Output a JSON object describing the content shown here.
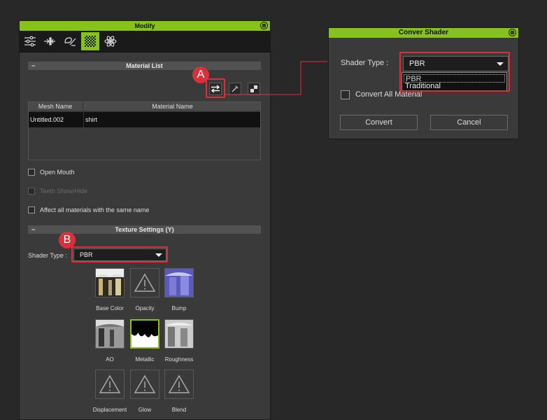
{
  "modify_panel": {
    "title": "Modify",
    "close_glyph": "⊗",
    "tabs": [
      {
        "name": "sliders-icon"
      },
      {
        "name": "motion-icon"
      },
      {
        "name": "attribute-icon"
      },
      {
        "name": "material-icon",
        "active": true
      },
      {
        "name": "physics-icon"
      }
    ],
    "material_list": {
      "collapse_glyph": "−",
      "header": "Material List",
      "columns": [
        "Mesh Name",
        "Material Name"
      ],
      "rows": [
        {
          "mesh": "Untitled.002",
          "material": "shirt"
        }
      ]
    },
    "options": {
      "open_mouth": "Open Mouth",
      "teeth": "Teeth Show/Hide",
      "affect_all": "Affect all materials with the same name"
    },
    "texture_settings": {
      "collapse_glyph": "−",
      "header": "Texture Settings  (Y)",
      "shader_type_label": "Shader Type :",
      "shader_type_value": "PBR",
      "channels": [
        {
          "label": "Base Color"
        },
        {
          "label": "Opacity"
        },
        {
          "label": "Bump"
        },
        {
          "label": "AO"
        },
        {
          "label": "Metallic"
        },
        {
          "label": "Roughness"
        },
        {
          "label": "Displacement"
        },
        {
          "label": "Glow"
        },
        {
          "label": "Blend"
        }
      ]
    }
  },
  "markers": {
    "a": "A",
    "b": "B"
  },
  "dialog": {
    "title": "Conver Shader",
    "close_glyph": "⊗",
    "shader_type_label": "Shader Type :",
    "shader_type_value": "PBR",
    "options": [
      "PBR",
      "Traditional"
    ],
    "convert_all_label": "Convert All Material",
    "convert_button": "Convert",
    "cancel_button": "Cancel"
  },
  "colors": {
    "accent": "#86c21a",
    "highlight_red": "#d9313a"
  }
}
